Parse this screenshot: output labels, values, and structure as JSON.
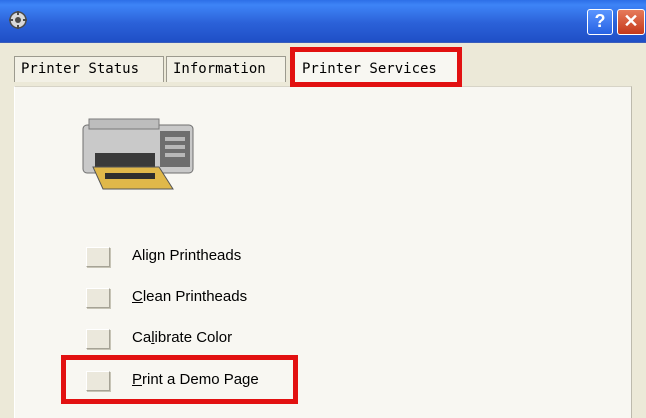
{
  "window": {
    "help_label": "?",
    "close_label": "✕",
    "app_icon": "printer-gear-icon"
  },
  "tabs": [
    {
      "label": "Printer Status"
    },
    {
      "label": "Information"
    },
    {
      "label": "Printer Services"
    }
  ],
  "services": [
    {
      "access": "",
      "rest": "Align Printheads"
    },
    {
      "access": "C",
      "rest": "lean Printheads"
    },
    {
      "pre": "Ca",
      "access": "l",
      "rest": "ibrate Color"
    },
    {
      "access": "P",
      "rest": "rint a Demo Page"
    }
  ],
  "highlight_color": "#e21111"
}
